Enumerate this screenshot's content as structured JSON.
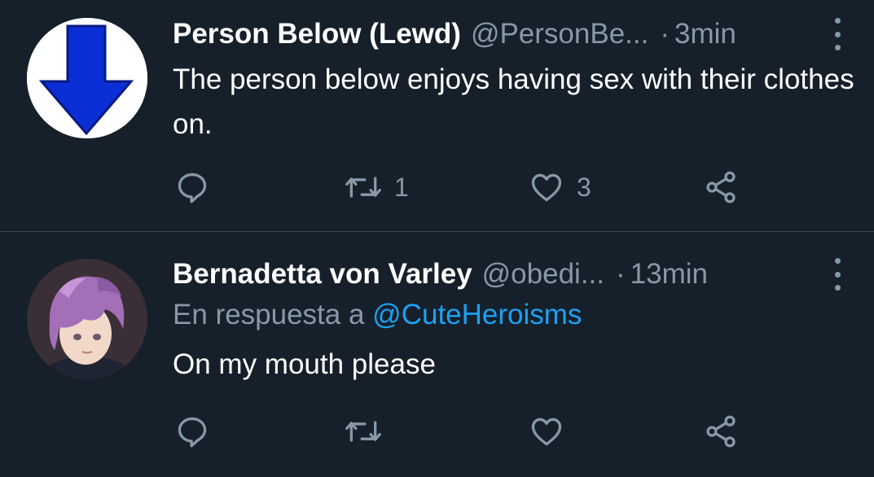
{
  "colors": {
    "background": "#15202b",
    "divider": "#38444d",
    "secondary_text": "#8899a6",
    "mention": "#1da1f2",
    "avatar_arrow": "#0a2fd6"
  },
  "tweets": [
    {
      "display_name": "Person Below (Lewd)",
      "handle": "@PersonBe...",
      "separator": "·",
      "time": "3min",
      "text": "The person below enjoys having sex with their clothes on.",
      "actions": {
        "reply_count": "",
        "retweet_count": "1",
        "like_count": "3"
      },
      "icons": [
        "down-arrow-avatar",
        "reply-icon",
        "retweet-icon",
        "like-icon",
        "share-icon",
        "more-icon"
      ]
    },
    {
      "display_name": "Bernadetta von Varley",
      "handle": "@obedi...",
      "separator": "·",
      "time": "13min",
      "reply_prefix": "En respuesta a",
      "reply_mention": "@CuteHeroisms",
      "text": "On my mouth please",
      "actions": {
        "reply_count": "",
        "retweet_count": "",
        "like_count": ""
      },
      "icons": [
        "anime-character-avatar",
        "reply-icon",
        "retweet-icon",
        "like-icon",
        "share-icon",
        "more-icon"
      ]
    }
  ]
}
